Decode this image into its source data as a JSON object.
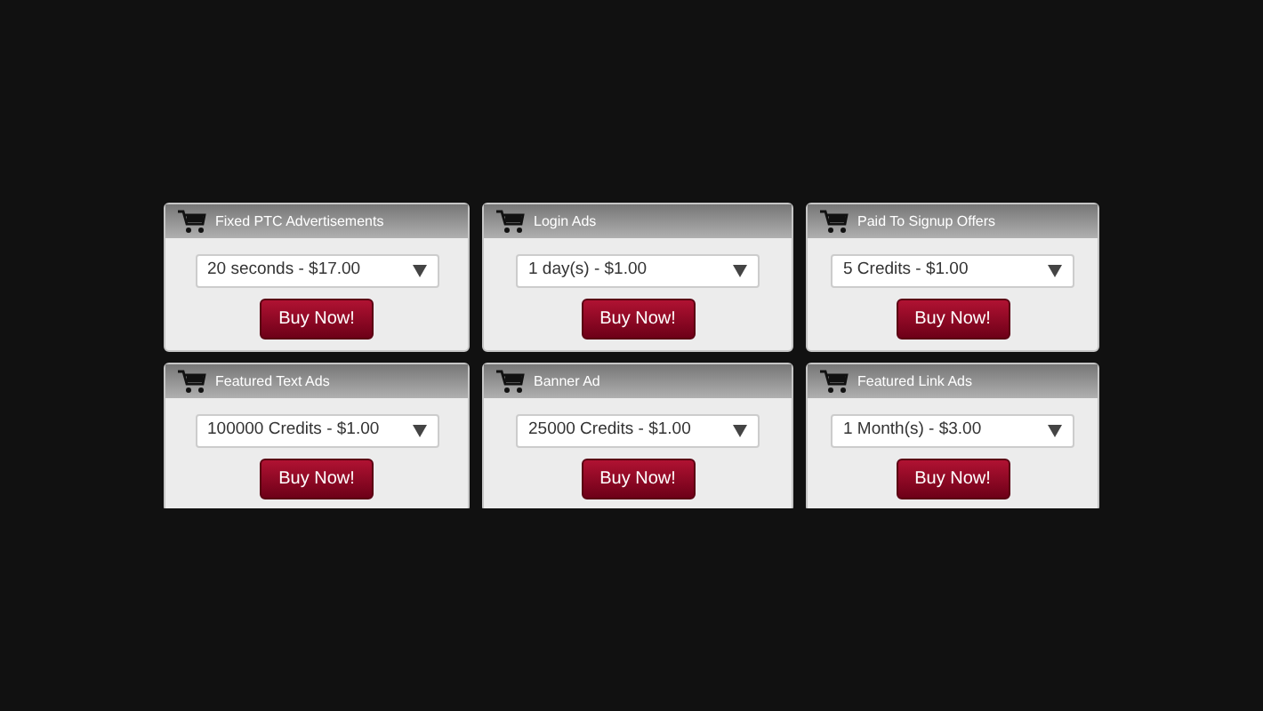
{
  "offers": [
    {
      "title": "Fixed PTC Advertisements",
      "option": "20 seconds - $17.00",
      "button": "Buy Now!"
    },
    {
      "title": "Login Ads",
      "option": "1 day(s) - $1.00",
      "button": "Buy Now!"
    },
    {
      "title": "Paid To Signup Offers",
      "option": "5 Credits - $1.00",
      "button": "Buy Now!"
    },
    {
      "title": "Featured Text Ads",
      "option": "100000 Credits - $1.00",
      "button": "Buy Now!"
    },
    {
      "title": "Banner Ad",
      "option": "25000 Credits - $1.00",
      "button": "Buy Now!"
    },
    {
      "title": "Featured Link Ads",
      "option": "1 Month(s) - $3.00",
      "button": "Buy Now!"
    }
  ]
}
